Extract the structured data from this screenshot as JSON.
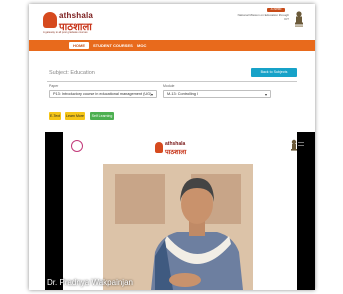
{
  "header": {
    "logo_en": "athshala",
    "logo_hi": "पाठशाला",
    "logo_tagline": "A gateway to all post graduate courses",
    "top_badge": "An MHRD Project",
    "ministry": "National Mission on Education through ICT",
    "emblem_icon": "national-emblem-icon"
  },
  "nav": {
    "home": "HOME",
    "courses": "STUDENT COURSES",
    "moc": "MOC"
  },
  "page": {
    "subject_title": "Subject: Education",
    "back_button": "Back to Subjects"
  },
  "filters": {
    "paper_label": "Paper",
    "paper_value": "P13: Introductory course in educational management (UG)",
    "module_label": "Module",
    "module_value": "M-13: Controlling I"
  },
  "content_tabs": {
    "etext": "E-Text",
    "learn_more": "Learn More",
    "self_learning": "Self Learning"
  },
  "video": {
    "logo_en": "athshala",
    "logo_hi": "पाठशाला",
    "caption": "Dr. Pradnya Wakpainjan"
  },
  "colors": {
    "nav_orange": "#e86a1c",
    "back_button_blue": "#17a2c8",
    "tab_yellow": "#f5c518",
    "tab_green": "#4caf50"
  }
}
